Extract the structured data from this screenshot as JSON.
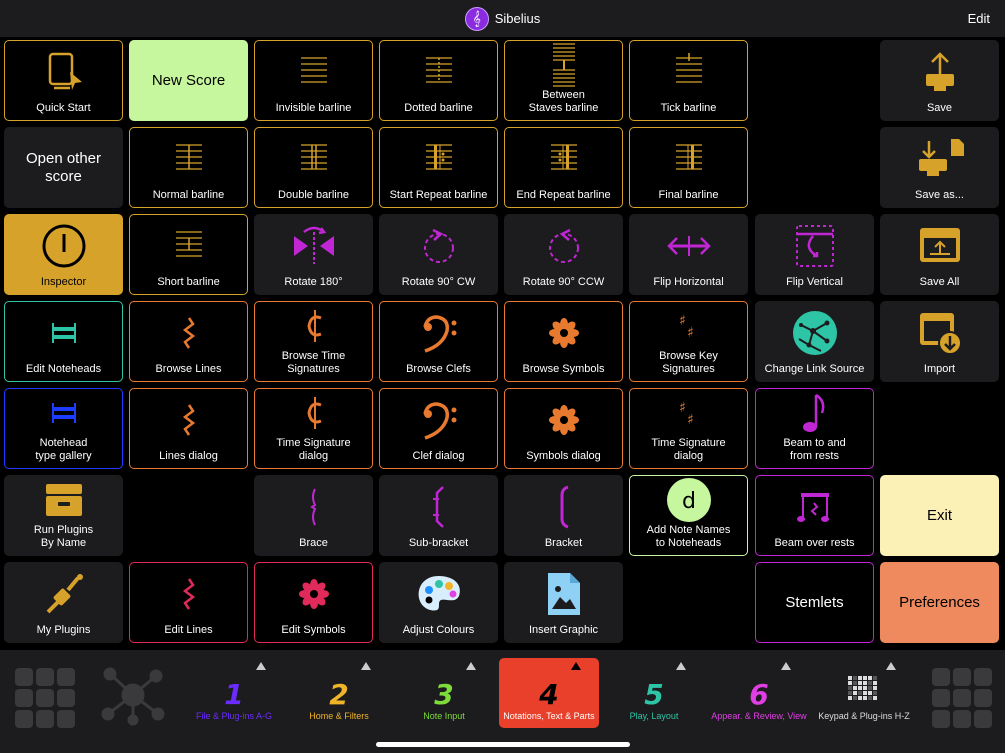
{
  "app": {
    "title": "Sibelius",
    "edit_label": "Edit",
    "logo_glyph": "𝄞"
  },
  "colors": {
    "gold": "#d6a22a",
    "purple": "#c026d3",
    "orange": "#e87a30",
    "teal": "#2ec4a6",
    "blue": "#1e3cff",
    "crimson": "#e02a5a",
    "green_bg": "#c6f79f",
    "yellow_bg": "#fbf0b6",
    "salmon_bg": "#ef8a5f"
  },
  "cells": [
    {
      "id": "quick-start",
      "label": "Quick Start",
      "col": 0,
      "row": 0,
      "icon": "doc-cursor",
      "color": "#d6a22a",
      "border": "#d6a22a",
      "bg": "#000"
    },
    {
      "id": "new-score",
      "label": "New Score",
      "col": 1,
      "row": 0,
      "icon": "",
      "color": "#000",
      "border": "#c6f79f",
      "bg": "#c6f79f",
      "big": true,
      "text": "#000"
    },
    {
      "id": "invisible-barline",
      "label": "Invisible barline",
      "col": 2,
      "row": 0,
      "icon": "staff-invisible",
      "color": "#d6a22a",
      "border": "#d6a22a",
      "bg": "#000"
    },
    {
      "id": "dotted-barline",
      "label": "Dotted barline",
      "col": 3,
      "row": 0,
      "icon": "staff-dotted",
      "color": "#d6a22a",
      "border": "#d6a22a",
      "bg": "#000"
    },
    {
      "id": "between-staves-barline",
      "label": "Between\nStaves barline",
      "col": 4,
      "row": 0,
      "icon": "staff-between",
      "color": "#d6a22a",
      "border": "#d6a22a",
      "bg": "#000"
    },
    {
      "id": "tick-barline",
      "label": "Tick barline",
      "col": 5,
      "row": 0,
      "icon": "staff-tick",
      "color": "#d6a22a",
      "border": "#d6a22a",
      "bg": "#000"
    },
    {
      "id": "save",
      "label": "Save",
      "col": 7,
      "row": 0,
      "icon": "save-icon",
      "color": "#d6a22a",
      "border": "#1c1c1e",
      "bg": "#1c1c1e"
    },
    {
      "id": "open-other-score",
      "label": "Open other\nscore",
      "col": 0,
      "row": 1,
      "icon": "",
      "color": "#fff",
      "border": "#1c1c1e",
      "bg": "#1c1c1e",
      "big": true
    },
    {
      "id": "normal-barline",
      "label": "Normal barline",
      "col": 1,
      "row": 1,
      "icon": "staff-normal",
      "color": "#d6a22a",
      "border": "#d6a22a",
      "bg": "#000"
    },
    {
      "id": "double-barline",
      "label": "Double barline",
      "col": 2,
      "row": 1,
      "icon": "staff-double",
      "color": "#d6a22a",
      "border": "#d6a22a",
      "bg": "#000"
    },
    {
      "id": "start-repeat-barline",
      "label": "Start Repeat barline",
      "col": 3,
      "row": 1,
      "icon": "staff-start-repeat",
      "color": "#d6a22a",
      "border": "#d6a22a",
      "bg": "#000"
    },
    {
      "id": "end-repeat-barline",
      "label": "End Repeat barline",
      "col": 4,
      "row": 1,
      "icon": "staff-end-repeat",
      "color": "#d6a22a",
      "border": "#d6a22a",
      "bg": "#000"
    },
    {
      "id": "final-barline",
      "label": "Final barline",
      "col": 5,
      "row": 1,
      "icon": "staff-final",
      "color": "#d6a22a",
      "border": "#d6a22a",
      "bg": "#000"
    },
    {
      "id": "save-as",
      "label": "Save as...",
      "col": 7,
      "row": 1,
      "icon": "save-as-icon",
      "color": "#d6a22a",
      "border": "#1c1c1e",
      "bg": "#1c1c1e"
    },
    {
      "id": "inspector",
      "label": "Inspector",
      "col": 0,
      "row": 2,
      "icon": "power-icon",
      "color": "#000",
      "border": "#d6a22a",
      "bg": "#d6a22a"
    },
    {
      "id": "short-barline",
      "label": "Short barline",
      "col": 1,
      "row": 2,
      "icon": "staff-short",
      "color": "#d6a22a",
      "border": "#d6a22a",
      "bg": "#000"
    },
    {
      "id": "rotate-180",
      "label": "Rotate 180°",
      "col": 2,
      "row": 2,
      "icon": "rotate-180-icon",
      "color": "#c026d3",
      "border": "#1c1c1e",
      "bg": "#1c1c1e"
    },
    {
      "id": "rotate-90-cw",
      "label": "Rotate 90° CW",
      "col": 3,
      "row": 2,
      "icon": "rotate-cw-icon",
      "color": "#c026d3",
      "border": "#1c1c1e",
      "bg": "#1c1c1e"
    },
    {
      "id": "rotate-90-ccw",
      "label": "Rotate 90° CCW",
      "col": 4,
      "row": 2,
      "icon": "rotate-ccw-icon",
      "color": "#c026d3",
      "border": "#1c1c1e",
      "bg": "#1c1c1e"
    },
    {
      "id": "flip-horizontal",
      "label": "Flip Horizontal",
      "col": 5,
      "row": 2,
      "icon": "flip-h-icon",
      "color": "#c026d3",
      "border": "#1c1c1e",
      "bg": "#1c1c1e"
    },
    {
      "id": "flip-vertical",
      "label": "Flip Vertical",
      "col": 6,
      "row": 2,
      "icon": "flip-v-icon",
      "color": "#c026d3",
      "border": "#1c1c1e",
      "bg": "#1c1c1e"
    },
    {
      "id": "save-all",
      "label": "Save All",
      "col": 7,
      "row": 2,
      "icon": "save-all-icon",
      "color": "#d6a22a",
      "border": "#1c1c1e",
      "bg": "#1c1c1e"
    },
    {
      "id": "edit-noteheads",
      "label": "Edit Noteheads",
      "col": 0,
      "row": 3,
      "icon": "notehead-icon",
      "color": "#2ec4a6",
      "border": "#2ec4a6",
      "bg": "#000"
    },
    {
      "id": "browse-lines",
      "label": "Browse Lines",
      "col": 1,
      "row": 3,
      "icon": "squiggle-icon",
      "color": "#e87a30",
      "border": "#e87a30",
      "bg": "#000"
    },
    {
      "id": "browse-time-signatures",
      "label": "Browse Time\nSignatures",
      "col": 2,
      "row": 3,
      "icon": "cut-time-icon",
      "color": "#e87a30",
      "border": "#e87a30",
      "bg": "#000"
    },
    {
      "id": "browse-clefs",
      "label": "Browse Clefs",
      "col": 3,
      "row": 3,
      "icon": "bass-clef-icon",
      "color": "#e87a30",
      "border": "#e87a30",
      "bg": "#000"
    },
    {
      "id": "browse-symbols",
      "label": "Browse Symbols",
      "col": 4,
      "row": 3,
      "icon": "flower-icon",
      "color": "#e87a30",
      "border": "#e87a30",
      "bg": "#000"
    },
    {
      "id": "browse-key-signatures",
      "label": "Browse Key\nSignatures",
      "col": 5,
      "row": 3,
      "icon": "sharps-icon",
      "color": "#e87a30",
      "border": "#e87a30",
      "bg": "#000"
    },
    {
      "id": "change-link-source",
      "label": "Change Link Source",
      "col": 6,
      "row": 3,
      "icon": "globe-icon",
      "color": "#2ec4a6",
      "border": "#1c1c1e",
      "bg": "#1c1c1e"
    },
    {
      "id": "import",
      "label": "Import",
      "col": 7,
      "row": 3,
      "icon": "import-icon",
      "color": "#d6a22a",
      "border": "#1c1c1e",
      "bg": "#1c1c1e"
    },
    {
      "id": "notehead-type-gallery",
      "label": "Notehead\ntype gallery",
      "col": 0,
      "row": 4,
      "icon": "notehead-blue-icon",
      "color": "#1e3cff",
      "border": "#1e3cff",
      "bg": "#000"
    },
    {
      "id": "lines-dialog",
      "label": "Lines dialog",
      "col": 1,
      "row": 4,
      "icon": "squiggle-icon",
      "color": "#e87a30",
      "border": "#e87a30",
      "bg": "#000"
    },
    {
      "id": "time-signature-dialog",
      "label": "Time Signature\ndialog",
      "col": 2,
      "row": 4,
      "icon": "cut-time-icon",
      "color": "#e87a30",
      "border": "#e87a30",
      "bg": "#000"
    },
    {
      "id": "clef-dialog",
      "label": "Clef dialog",
      "col": 3,
      "row": 4,
      "icon": "bass-clef-icon",
      "color": "#e87a30",
      "border": "#e87a30",
      "bg": "#000"
    },
    {
      "id": "symbols-dialog",
      "label": "Symbols dialog",
      "col": 4,
      "row": 4,
      "icon": "flower-icon",
      "color": "#e87a30",
      "border": "#e87a30",
      "bg": "#000"
    },
    {
      "id": "key-signature-dialog",
      "label": "Time Signature\ndialog",
      "col": 5,
      "row": 4,
      "icon": "sharps-icon",
      "color": "#e87a30",
      "border": "#e87a30",
      "bg": "#000"
    },
    {
      "id": "beam-to-and-from-rests",
      "label": "Beam to and\nfrom rests",
      "col": 6,
      "row": 4,
      "icon": "eighth-note-icon",
      "color": "#c026d3",
      "border": "#c026d3",
      "bg": "#000"
    },
    {
      "id": "run-plugins-by-name",
      "label": "Run Plugins\nBy Name",
      "col": 0,
      "row": 5,
      "icon": "drawer-icon",
      "color": "#d6a22a",
      "border": "#1c1c1e",
      "bg": "#1c1c1e"
    },
    {
      "id": "brace",
      "label": "Brace",
      "col": 2,
      "row": 5,
      "icon": "brace-icon",
      "color": "#c026d3",
      "border": "#1c1c1e",
      "bg": "#1c1c1e"
    },
    {
      "id": "sub-bracket",
      "label": "Sub-bracket",
      "col": 3,
      "row": 5,
      "icon": "sub-bracket-icon",
      "color": "#c026d3",
      "border": "#1c1c1e",
      "bg": "#1c1c1e"
    },
    {
      "id": "bracket",
      "label": "Bracket",
      "col": 4,
      "row": 5,
      "icon": "bracket-icon",
      "color": "#c026d3",
      "border": "#1c1c1e",
      "bg": "#1c1c1e"
    },
    {
      "id": "add-note-names",
      "label": "Add Note Names\nto Noteheads",
      "col": 5,
      "row": 5,
      "icon": "note-name-icon",
      "color": "#c6f79f",
      "border": "#c6f79f",
      "bg": "#000"
    },
    {
      "id": "beam-over-rests",
      "label": "Beam over rests",
      "col": 6,
      "row": 5,
      "icon": "beam-rest-icon",
      "color": "#c026d3",
      "border": "#c026d3",
      "bg": "#000"
    },
    {
      "id": "exit",
      "label": "Exit",
      "col": 7,
      "row": 5,
      "icon": "",
      "color": "#000",
      "border": "#fbf0b6",
      "bg": "#fbf0b6",
      "big": true,
      "text": "#000"
    },
    {
      "id": "my-plugins",
      "label": "My Plugins",
      "col": 0,
      "row": 6,
      "icon": "plug-icon",
      "color": "#d6a22a",
      "border": "#1c1c1e",
      "bg": "#1c1c1e"
    },
    {
      "id": "edit-lines",
      "label": "Edit Lines",
      "col": 1,
      "row": 6,
      "icon": "squiggle-icon",
      "color": "#e02a5a",
      "border": "#e02a5a",
      "bg": "#000"
    },
    {
      "id": "edit-symbols",
      "label": "Edit Symbols",
      "col": 2,
      "row": 6,
      "icon": "flower-icon",
      "color": "#e02a5a",
      "border": "#e02a5a",
      "bg": "#000"
    },
    {
      "id": "adjust-colours",
      "label": "Adjust Colours",
      "col": 3,
      "row": 6,
      "icon": "palette-icon",
      "color": "#d9eefc",
      "border": "#1c1c1e",
      "bg": "#1c1c1e"
    },
    {
      "id": "insert-graphic",
      "label": "Insert Graphic",
      "col": 4,
      "row": 6,
      "icon": "image-file-icon",
      "color": "#8fd0f5",
      "border": "#1c1c1e",
      "bg": "#1c1c1e"
    },
    {
      "id": "stemlets",
      "label": "Stemlets",
      "col": 6,
      "row": 6,
      "icon": "",
      "color": "#fff",
      "border": "#c026d3",
      "bg": "#000",
      "big": true
    },
    {
      "id": "preferences",
      "label": "Preferences",
      "col": 7,
      "row": 6,
      "icon": "",
      "color": "#000",
      "border": "#ef8a5f",
      "bg": "#ef8a5f",
      "big": true,
      "text": "#000"
    }
  ],
  "tabs": [
    {
      "num": "1",
      "label": "File & Plug-ins A-G",
      "color": "#6b2bff",
      "active": false
    },
    {
      "num": "2",
      "label": "Home & Filters",
      "color": "#f0b429",
      "active": false
    },
    {
      "num": "3",
      "label": "Note Input",
      "color": "#7ddc3a",
      "active": false
    },
    {
      "num": "4",
      "label": "Notations, Text & Parts",
      "color": "#000",
      "active": true
    },
    {
      "num": "5",
      "label": "Play, Layout",
      "color": "#2ec4a6",
      "active": false
    },
    {
      "num": "6",
      "label": "Appear. & Review, View",
      "color": "#e23ee6",
      "active": false
    },
    {
      "num": "",
      "label": "Keypad & Plug-ins H-Z",
      "color": "#fff",
      "active": false,
      "icon": "keypad-grid-icon"
    }
  ]
}
